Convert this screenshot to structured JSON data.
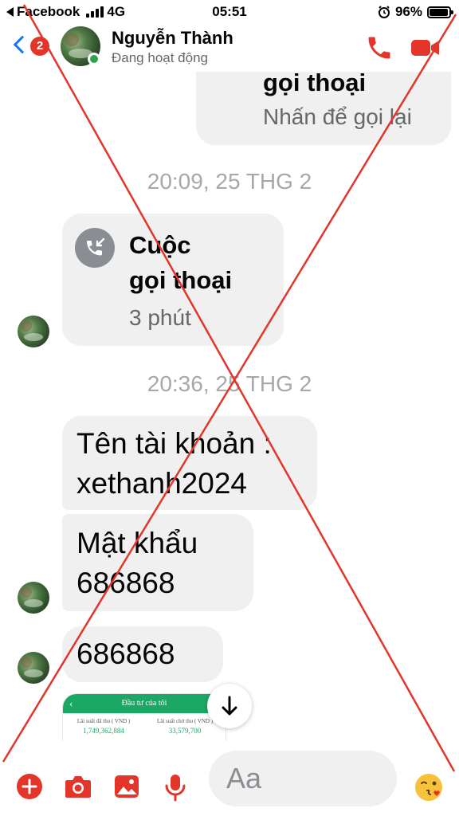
{
  "status_bar": {
    "carrier": "Facebook",
    "network": "4G",
    "time": "05:51",
    "battery": "96%",
    "battery_level": 0.96
  },
  "header": {
    "unread_count": "2",
    "contact_name": "Nguyễn Thành",
    "contact_status": "Đang hoạt động"
  },
  "messages": {
    "prev_call": {
      "title": "gọi thoại",
      "subtitle": "Nhấn để gọi lại"
    },
    "timestamp_1": "20:09, 25 THG 2",
    "call": {
      "title_line1": "Cuộc",
      "title_line2": "gọi thoại",
      "duration": "3 phút"
    },
    "timestamp_2": "20:36, 25 THG 2",
    "text_1": {
      "line1": "Tên tài khoản :",
      "line2": "xethanh2024"
    },
    "text_2": {
      "line1": "Mật khẩu",
      "line2": "686868"
    },
    "text_3": "686868",
    "image_preview": {
      "title": "Đầu tư của tôi",
      "col1_label": "Lãi suất đã thu ( VND )",
      "col1_value": "1,749,362,884",
      "col2_label": "Lãi suất chờ thu ( VND )",
      "col2_value": "33,579,700"
    }
  },
  "composer": {
    "placeholder": "Aa"
  },
  "colors": {
    "accent_red": "#e4352b",
    "messenger_blue": "#1877f2",
    "bubble_gray": "#f0f0f0",
    "online_green": "#31a24c",
    "watermark_red": "#e4352b"
  },
  "icons": [
    "back-chevron-icon",
    "phone-icon",
    "video-camera-icon",
    "missed-call-icon",
    "arrow-down-icon",
    "plus-icon",
    "camera-icon",
    "gallery-icon",
    "microphone-icon",
    "emoji-icon",
    "winking-kiss-emoji-icon"
  ]
}
